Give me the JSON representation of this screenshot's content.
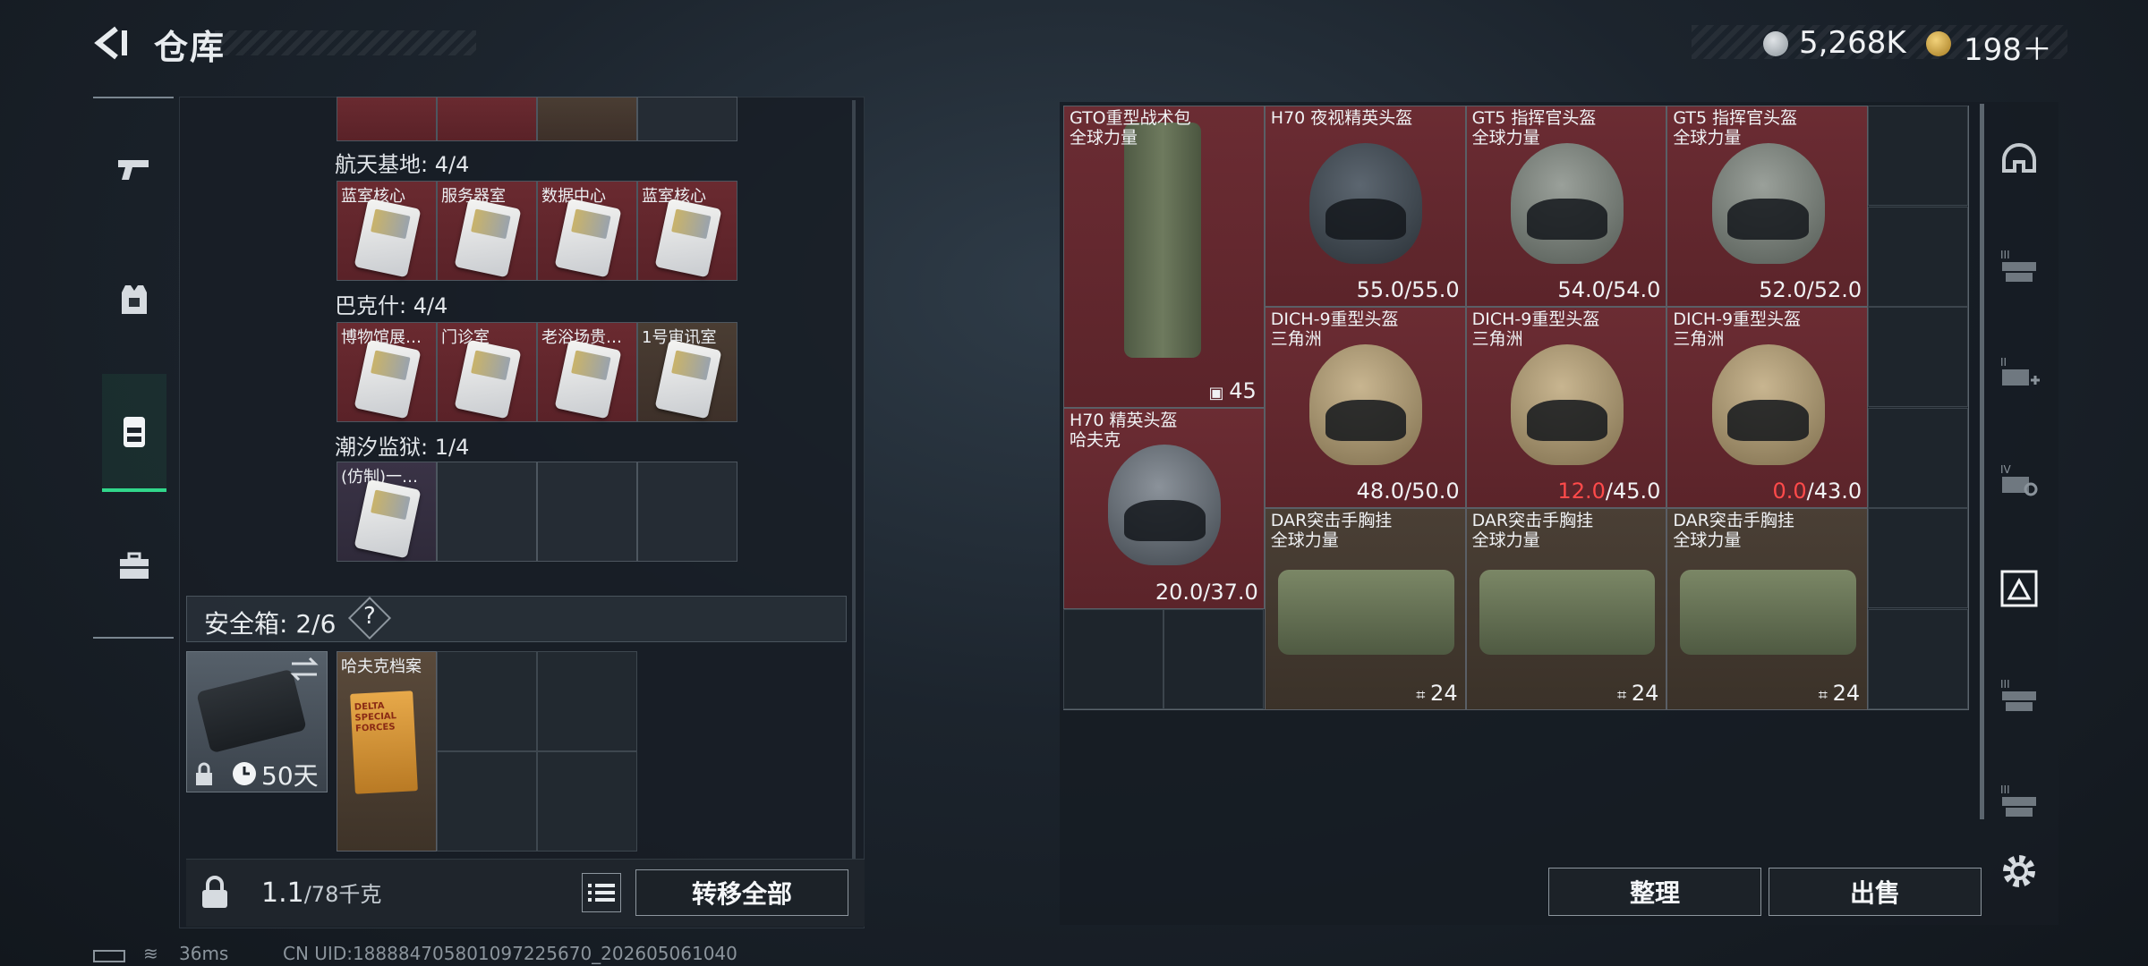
{
  "header": {
    "title": "仓库",
    "currencies": [
      {
        "icon": "silver-coin-icon",
        "value": "5,268K"
      },
      {
        "icon": "gold-coin-icon",
        "value": "198＋"
      }
    ]
  },
  "left_nav": {
    "items": [
      {
        "name": "weapons",
        "icon": "pistol-icon"
      },
      {
        "name": "armor",
        "icon": "vest-icon"
      },
      {
        "name": "backpack",
        "icon": "backpack-icon",
        "active": true
      },
      {
        "name": "toolbox",
        "icon": "toolbox-icon"
      }
    ]
  },
  "keycard_sections": [
    {
      "title": "航天基地: 4/4",
      "cards": [
        {
          "label": "蓝室核心",
          "color": "red"
        },
        {
          "label": "服务器室",
          "color": "red"
        },
        {
          "label": "数据中心",
          "color": "red"
        },
        {
          "label": "蓝室核心",
          "color": "red"
        }
      ]
    },
    {
      "title": "巴克什: 4/4",
      "cards": [
        {
          "label": "博物馆展…",
          "color": "red"
        },
        {
          "label": "门诊室",
          "color": "red"
        },
        {
          "label": "老浴场贵…",
          "color": "red"
        },
        {
          "label": "1号审讯室",
          "color": "brown"
        }
      ]
    },
    {
      "title": "潮汐监狱: 1/4",
      "cards": [
        {
          "label": "(仿制)一…",
          "color": "purple"
        }
      ]
    }
  ],
  "safe": {
    "label": "安全箱: 2/6",
    "help": "?",
    "days": "50天",
    "item": {
      "name": "哈夫克档案",
      "cover_text": "DELTA SPECIAL FORCES"
    }
  },
  "bottom_left": {
    "weight_value": "1.1",
    "weight_max": "/78千克",
    "transfer_all": "转移全部"
  },
  "items": [
    {
      "name_line1": "GTO重型战术包",
      "name_line2": "全球力量",
      "kind": "backpack",
      "count": "45"
    },
    {
      "name_line1": "H70 夜视精英头盔",
      "name_line2": "",
      "kind": "nv",
      "durability": "55.0",
      "max": "/55.0"
    },
    {
      "name_line1": "GT5 指挥官头盔",
      "name_line2": "全球力量",
      "kind": "gt",
      "durability": "54.0",
      "max": "/54.0"
    },
    {
      "name_line1": "GT5 指挥官头盔",
      "name_line2": "全球力量",
      "kind": "gt",
      "durability": "52.0",
      "max": "/52.0"
    },
    {
      "name_line1": "DICH-9重型头盔",
      "name_line2": "三角洲",
      "kind": "dich",
      "durability": "48.0",
      "max": "/50.0"
    },
    {
      "name_line1": "DICH-9重型头盔",
      "name_line2": "三角洲",
      "kind": "dich",
      "durability": "12.0",
      "max": "/45.0",
      "low": true
    },
    {
      "name_line1": "DICH-9重型头盔",
      "name_line2": "三角洲",
      "kind": "dich",
      "durability": "0.0",
      "max": "/43.0",
      "low": true
    },
    {
      "name_line1": "H70 精英头盔",
      "name_line2": "哈夫克",
      "kind": "h70",
      "durability": "20.0",
      "max": "/37.0"
    },
    {
      "name_line1": "DAR突击手胸挂",
      "name_line2": "全球力量",
      "kind": "rig",
      "count": "24"
    },
    {
      "name_line1": "DAR突击手胸挂",
      "name_line2": "全球力量",
      "kind": "rig",
      "count": "24"
    },
    {
      "name_line1": "DAR突击手胸挂",
      "name_line2": "全球力量",
      "kind": "rig",
      "count": "24"
    }
  ],
  "right_buttons": {
    "sort": "整理",
    "sell": "出售"
  },
  "status_bar": {
    "ping": "36ms",
    "uid": "CN UID:18888470580109722567​0_202605061040"
  },
  "colors": {
    "accent": "#31d78b",
    "item_red": "#6b2c33",
    "item_brown": "#4a3f35",
    "low_durability": "#ff4a4a"
  }
}
